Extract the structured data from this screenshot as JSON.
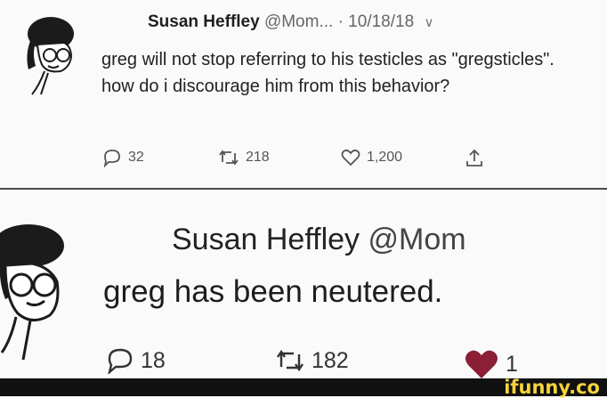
{
  "tweet1": {
    "name": "Susan Heffley",
    "handle": "@Mom...",
    "date": "· 10/18/18",
    "text": "greg will not stop referring to his testicles as \"gregsticles\". how do i discourage him from this behavior?",
    "replies": "32",
    "retweets": "218",
    "likes": "1,200"
  },
  "tweet2": {
    "name": "Susan Heffley",
    "handle": "@Mom",
    "text": "greg has been neutered.",
    "replies": "18",
    "retweets": "182",
    "likes": "1"
  },
  "footer": {
    "brand": "ifunny.co"
  },
  "colors": {
    "liked_heart": "#8a1f35",
    "watermark": "#f6d33b"
  },
  "icons": [
    "avatar-cartoon-icon",
    "reply-icon",
    "retweet-icon",
    "like-icon",
    "share-icon",
    "chevron-down-icon",
    "liked-heart-icon"
  ]
}
